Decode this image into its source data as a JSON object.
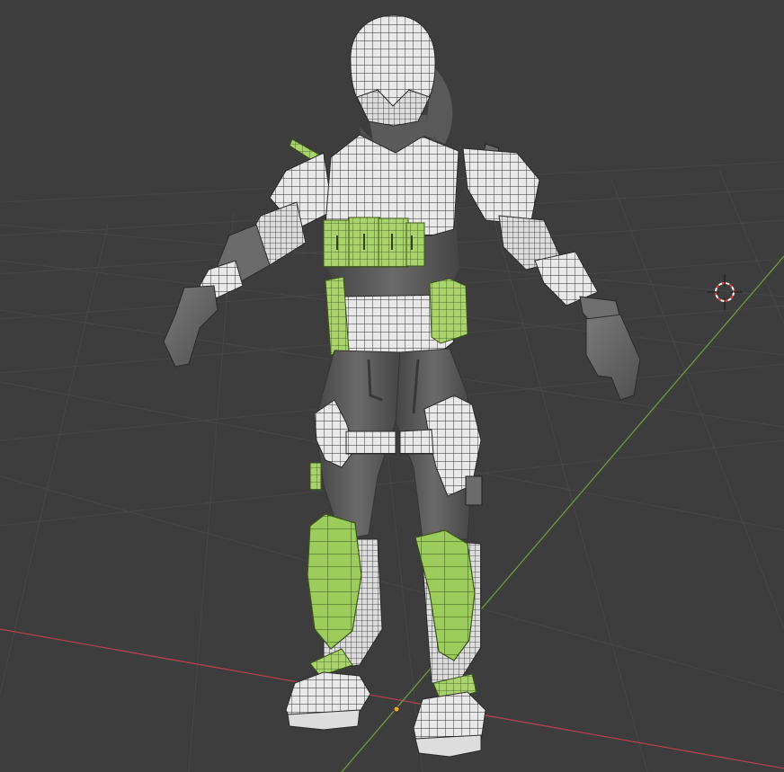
{
  "viewport": {
    "background": "#3d3d3d",
    "grid_color": "#474747",
    "x_axis_color": "#b2424f",
    "y_axis_color": "#6e9a3c"
  },
  "model": {
    "wire_fill": "#e9e9e9",
    "wire_line": "#2a2a2a",
    "selected_fill": "#a7d46a",
    "selected_line": "#3e5a1c",
    "cloth_fill": "#5c5c5c",
    "shadow_fill": "#4a4a4a"
  },
  "cursor_3d": {
    "icon": "3d-cursor-icon",
    "ring_a": "#e04848",
    "ring_b": "#ffffff"
  },
  "origin": {
    "icon": "origin-dot-icon",
    "color": "#f5a623"
  }
}
